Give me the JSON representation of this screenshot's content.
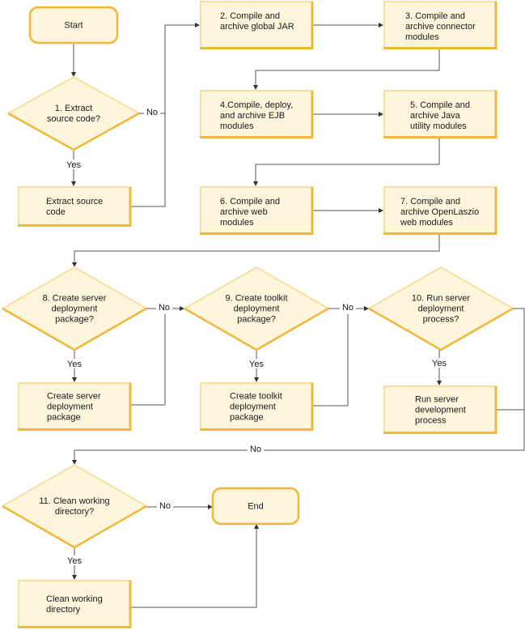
{
  "colors": {
    "fill": "#fef5dd",
    "border_light": "#f8dfa0",
    "border_dark": "#f0b838",
    "line": "#555555",
    "text": "#1a1a1a"
  },
  "nodes": [
    {
      "id": "start",
      "type": "terminal",
      "lines": [
        "Start"
      ]
    },
    {
      "id": "d1",
      "type": "decision",
      "lines": [
        "1. Extract",
        "source code?"
      ]
    },
    {
      "id": "p_extract",
      "type": "process",
      "lines": [
        "Extract source",
        "code"
      ]
    },
    {
      "id": "p2",
      "type": "process",
      "lines": [
        "2. Compile and",
        "archive global JAR"
      ]
    },
    {
      "id": "p3",
      "type": "process",
      "lines": [
        "3. Compile and",
        "archive connector",
        "modules"
      ]
    },
    {
      "id": "p4",
      "type": "process",
      "lines": [
        "4.Compile, deploy,",
        "and archive EJB",
        "modules"
      ]
    },
    {
      "id": "p5",
      "type": "process",
      "lines": [
        "5. Compile and",
        "archive Java",
        "utility modules"
      ]
    },
    {
      "id": "p6",
      "type": "process",
      "lines": [
        "6. Compile and",
        "archive web",
        "modules"
      ]
    },
    {
      "id": "p7",
      "type": "process",
      "lines": [
        "7. Compile and",
        "archive OpenLaszio",
        "web modules"
      ]
    },
    {
      "id": "d8",
      "type": "decision",
      "lines": [
        "8. Create server",
        "deployment",
        "package?"
      ]
    },
    {
      "id": "d9",
      "type": "decision",
      "lines": [
        "9. Create toolkit",
        "deployment",
        "package?"
      ]
    },
    {
      "id": "d10",
      "type": "decision",
      "lines": [
        "10. Run server",
        "deployment",
        "process?"
      ]
    },
    {
      "id": "p8",
      "type": "process",
      "lines": [
        "Create server",
        "deployment",
        "package"
      ]
    },
    {
      "id": "p9",
      "type": "process",
      "lines": [
        "Create toolkit",
        "deployment",
        "package"
      ]
    },
    {
      "id": "p10",
      "type": "process",
      "lines": [
        "Run server",
        "development",
        "process"
      ]
    },
    {
      "id": "d11",
      "type": "decision",
      "lines": [
        "11. Clean working",
        "directory?"
      ]
    },
    {
      "id": "end",
      "type": "terminal",
      "lines": [
        "End"
      ]
    },
    {
      "id": "p11",
      "type": "process",
      "lines": [
        "Clean working",
        "directory"
      ]
    }
  ],
  "edges": [
    {
      "from": "start",
      "to": "d1",
      "label": ""
    },
    {
      "from": "d1",
      "to": "p_extract",
      "label": "Yes"
    },
    {
      "from": "d1",
      "to": "p2",
      "label": "No"
    },
    {
      "from": "p_extract",
      "to": "p2",
      "label": ""
    },
    {
      "from": "p2",
      "to": "p3",
      "label": ""
    },
    {
      "from": "p3",
      "to": "p4",
      "label": ""
    },
    {
      "from": "p4",
      "to": "p5",
      "label": ""
    },
    {
      "from": "p5",
      "to": "p6",
      "label": ""
    },
    {
      "from": "p6",
      "to": "p7",
      "label": ""
    },
    {
      "from": "p7",
      "to": "d8",
      "label": ""
    },
    {
      "from": "d8",
      "to": "p8",
      "label": "Yes"
    },
    {
      "from": "d8",
      "to": "d9",
      "label": "No"
    },
    {
      "from": "p8",
      "to": "d9",
      "label": ""
    },
    {
      "from": "d9",
      "to": "p9",
      "label": "Yes"
    },
    {
      "from": "d9",
      "to": "d10",
      "label": "No"
    },
    {
      "from": "p9",
      "to": "d10",
      "label": ""
    },
    {
      "from": "d10",
      "to": "p10",
      "label": "Yes"
    },
    {
      "from": "d10",
      "to": "d11",
      "label": "No"
    },
    {
      "from": "p10",
      "to": "d11",
      "label": ""
    },
    {
      "from": "d11",
      "to": "p11",
      "label": "Yes"
    },
    {
      "from": "d11",
      "to": "end",
      "label": "No"
    },
    {
      "from": "p11",
      "to": "end",
      "label": ""
    }
  ]
}
